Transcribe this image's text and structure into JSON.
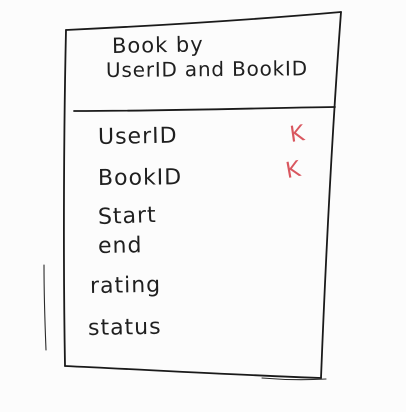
{
  "entity": {
    "title_line_1": "Book by",
    "title_line_2": "UserID and BookID"
  },
  "fields": [
    {
      "name": "UserID",
      "key": "K"
    },
    {
      "name": "BookID",
      "key": "K"
    },
    {
      "name": "Start",
      "key": ""
    },
    {
      "name": "end",
      "key": ""
    },
    {
      "name": "rating",
      "key": ""
    },
    {
      "name": "status",
      "key": ""
    }
  ],
  "colors": {
    "ink": "#1a1a1a",
    "key_mark": "#d9575f",
    "background": "#fcfcfc"
  }
}
